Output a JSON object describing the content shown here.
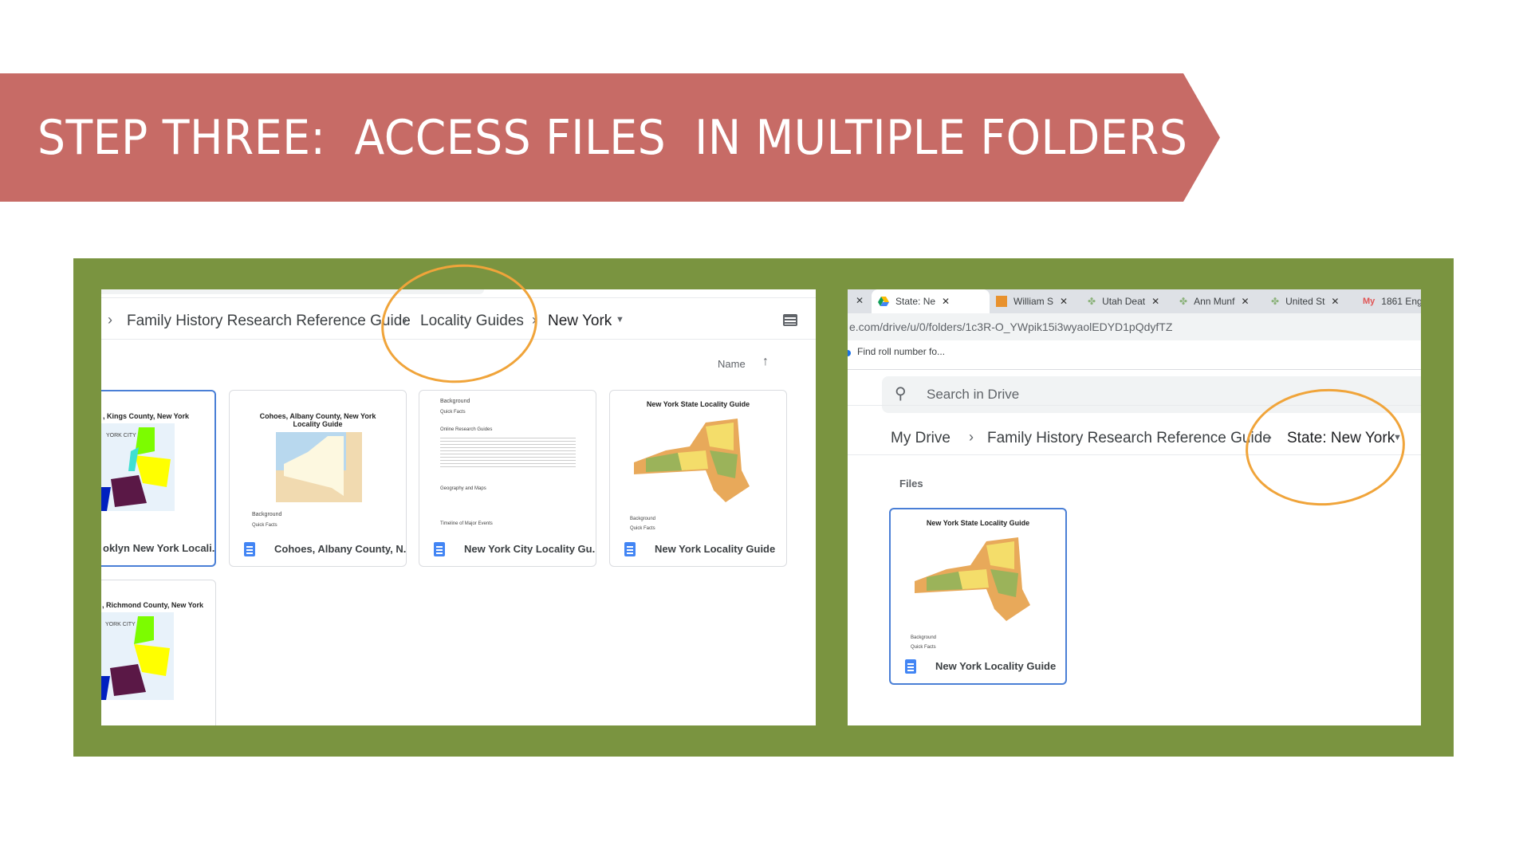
{
  "banner": {
    "title": "STEP THREE:  ACCESS FILES  IN MULTIPLE FOLDERS",
    "color": "#c76b66"
  },
  "frame_color": "#7a9440",
  "highlight_color": "#f0a43a",
  "left": {
    "breadcrumb": [
      "Family History Research Reference Guide",
      "Locality Guides",
      "New York"
    ],
    "sort_label": "Name",
    "cards": [
      {
        "label": "oklyn New York Locali...",
        "thumb_title": ", Kings County, New York",
        "map_label": "YORK CITY"
      },
      {
        "label": "Cohoes, Albany County, N...",
        "thumb_title": "Cohoes, Albany County, New York Locality Guide",
        "bg": "Background",
        "qf": "Quick Facts"
      },
      {
        "label": "New York City Locality Gu...",
        "bg": "Background",
        "sections": [
          "Quick Facts",
          "Online Research Guides",
          "Geography and Maps",
          "Timeline of Major Events"
        ]
      },
      {
        "label": "New York Locality Guide",
        "thumb_title": "New York State Locality Guide",
        "bg": "Background",
        "qf": "Quick Facts"
      },
      {
        "thumb_title": ", Richmond County, New York",
        "map_label": "YORK CITY"
      }
    ]
  },
  "right": {
    "tabs": [
      {
        "label": "State: Ne"
      },
      {
        "label": "William S"
      },
      {
        "label": "Utah Deat"
      },
      {
        "label": "Ann Munf"
      },
      {
        "label": "United St"
      },
      {
        "label": "1861 Eng"
      }
    ],
    "url": "e.com/drive/u/0/folders/1c3R-O_YWpik15i3wyaolEDYD1pQdyfTZ",
    "bookmark": "Find roll number fo...",
    "search_placeholder": "Search in Drive",
    "breadcrumb": [
      "My Drive",
      "Family History Research Reference Guide",
      "State: New York"
    ],
    "section": "Files",
    "card": {
      "label": "New York Locality Guide",
      "thumb_title": "New York State Locality Guide",
      "bg": "Background",
      "qf": "Quick Facts"
    }
  }
}
